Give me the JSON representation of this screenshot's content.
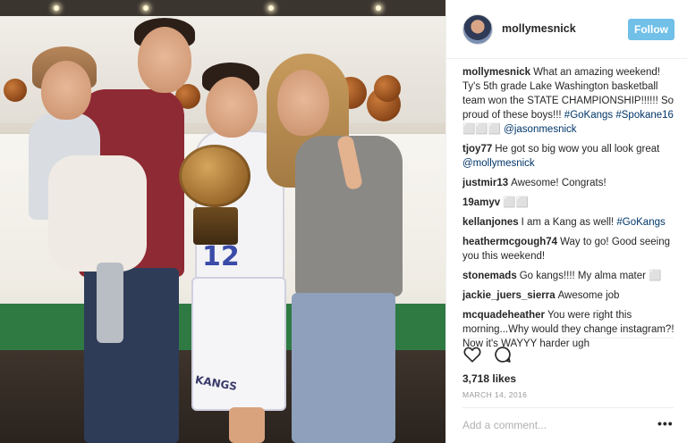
{
  "post": {
    "username": "mollymesnick",
    "follow_label": "Follow",
    "colors": {
      "follow": "#70c0e8",
      "link": "#003569",
      "text": "#262626",
      "muted": "#999999"
    }
  },
  "photo": {
    "jersey_number": "12",
    "shorts_text": "KANGS"
  },
  "comments": [
    {
      "user": "mollymesnick",
      "text": "What an amazing weekend! Ty's 5th grade Lake Washington basketball team won the STATE CHAMPIONSHIP!!!!!! So proud of these boys!!! ",
      "hashtag1": "#GoKangs",
      "hashtag2": "#Spokane16",
      "emoji": "⬜⬜⬜",
      "mention": "@jasonmesnick"
    },
    {
      "user": "tjoy77",
      "text": "He got so big wow you all look great ",
      "mention": "@mollymesnick"
    },
    {
      "user": "justmir13",
      "text": "Awesome! Congrats!"
    },
    {
      "user": "19amyv",
      "text": "⬜⬜"
    },
    {
      "user": "kellanjones",
      "text": "I am a Kang as well! ",
      "hashtag": "#GoKangs"
    },
    {
      "user": "heathermcgough74",
      "text": "Way to go! Good seeing you this weekend!"
    },
    {
      "user": "stonemads",
      "text": "Go kangs!!!! My alma mater ⬜"
    },
    {
      "user": "jackie_juers_sierra",
      "text": "Awesome job"
    },
    {
      "user": "mcquadeheather",
      "text": "You were right this morning...Why would they change instagram?! Now it's WAYYY harder ugh"
    }
  ],
  "actions": {
    "like_icon": "heart-icon",
    "comment_icon": "comment-icon"
  },
  "likes_text": "3,718 likes",
  "date_text": "MARCH 14, 2016",
  "add_comment_placeholder": "Add a comment...",
  "more_label": "•••"
}
